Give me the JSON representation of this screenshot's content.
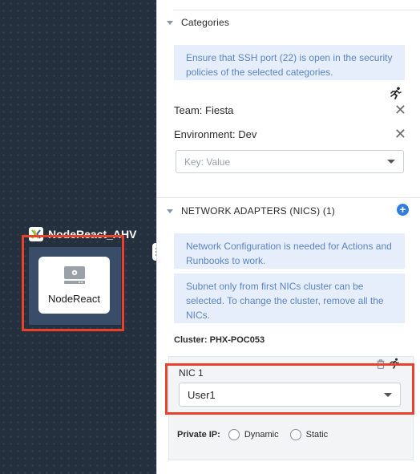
{
  "canvas": {
    "app_name": "NodeReact_AHV",
    "service_name": "NodeReact"
  },
  "categories": {
    "title": "Categories",
    "info": "Ensure that SSH port (22) is open in the security policies of the selected categories.",
    "items": [
      {
        "label": "Team: Fiesta"
      },
      {
        "label": "Environment: Dev"
      }
    ],
    "key_value_placeholder": "Key: Value"
  },
  "nics": {
    "title": "NETWORK ADAPTERS (NICS) (1)",
    "info_config": "Network Configuration is needed for Actions and Runbooks to work.",
    "info_subnet": "Subnet only from first NICs cluster can be selected. To change the cluster, remove all the NICs.",
    "cluster_label": "Cluster: PHX-POC053",
    "nic_label": "NIC 1",
    "nic_value": "User1",
    "private_ip_label": "Private IP:",
    "options": [
      "Dynamic",
      "Static"
    ]
  },
  "colors": {
    "canvas_bg": "#25303f",
    "info_bg": "#e6eefb",
    "info_text": "#5b84c4",
    "accent": "#2f7de1",
    "highlight": "#e8412c"
  }
}
